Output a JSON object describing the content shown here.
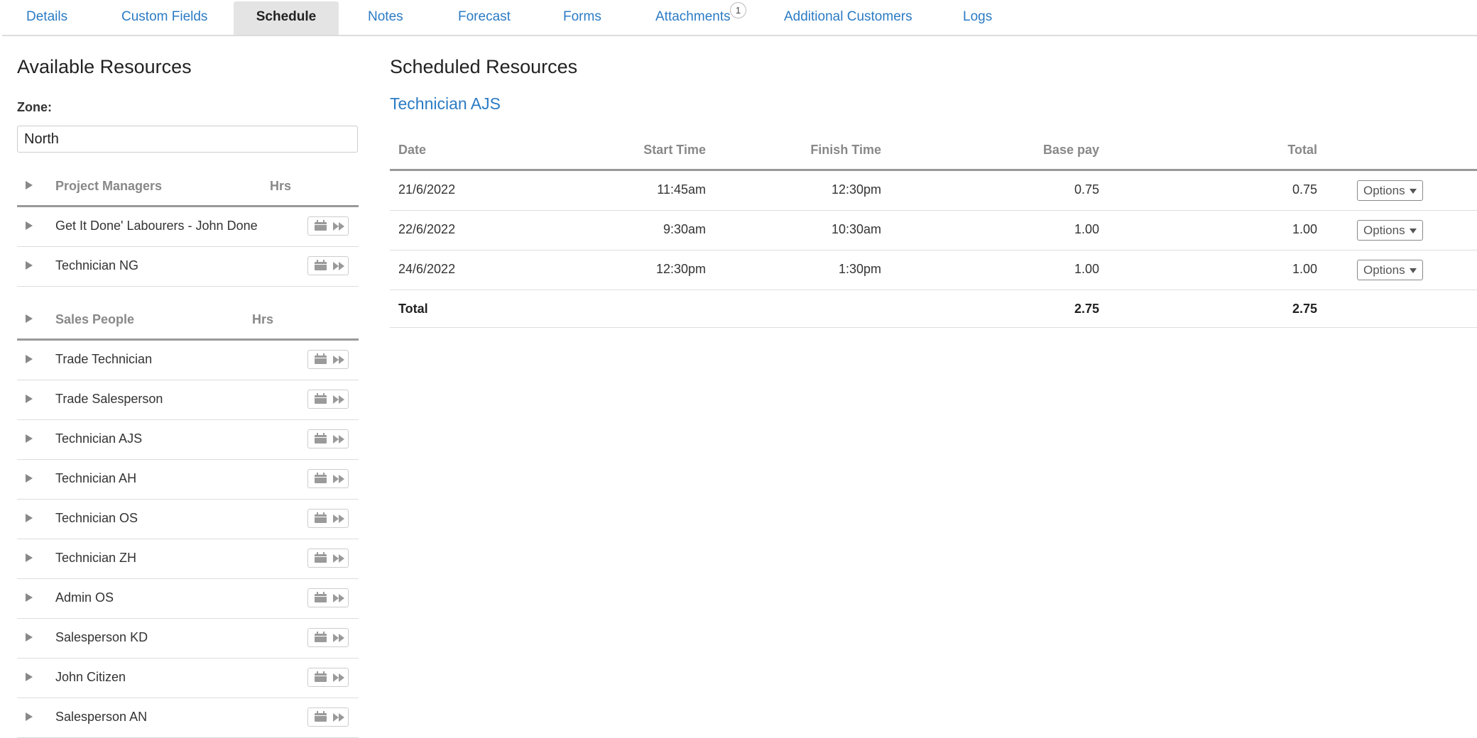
{
  "tabs": [
    {
      "label": "Details"
    },
    {
      "label": "Custom Fields"
    },
    {
      "label": "Schedule"
    },
    {
      "label": "Notes"
    },
    {
      "label": "Forecast"
    },
    {
      "label": "Forms"
    },
    {
      "label": "Attachments",
      "badge": "1"
    },
    {
      "label": "Additional Customers"
    },
    {
      "label": "Logs"
    }
  ],
  "available": {
    "title": "Available Resources",
    "zone_label": "Zone:",
    "zone_value": "North",
    "groups": [
      {
        "title": "Project Managers",
        "hrs_label": "Hrs",
        "items": [
          "Get It Done' Labourers - John Done",
          "Technician NG"
        ]
      },
      {
        "title": "Sales People",
        "hrs_label": "Hrs",
        "items": [
          "Trade Technician",
          "Trade Salesperson",
          "Technician AJS",
          "Technician AH",
          "Technician OS",
          "Technician ZH",
          "Admin OS",
          "Salesperson KD",
          "John Citizen",
          "Salesperson AN"
        ]
      }
    ]
  },
  "scheduled": {
    "title": "Scheduled Resources",
    "resource": "Technician AJS",
    "columns": {
      "date": "Date",
      "start": "Start Time",
      "finish": "Finish Time",
      "base": "Base pay",
      "total": "Total"
    },
    "rows": [
      {
        "date": "21/6/2022",
        "start": "11:45am",
        "finish": "12:30pm",
        "base": "0.75",
        "total": "0.75",
        "options": "Options"
      },
      {
        "date": "22/6/2022",
        "start": "9:30am",
        "finish": "10:30am",
        "base": "1.00",
        "total": "1.00",
        "options": "Options"
      },
      {
        "date": "24/6/2022",
        "start": "12:30pm",
        "finish": "1:30pm",
        "base": "1.00",
        "total": "1.00",
        "options": "Options"
      }
    ],
    "totals": {
      "label": "Total",
      "base": "2.75",
      "total": "2.75"
    }
  }
}
